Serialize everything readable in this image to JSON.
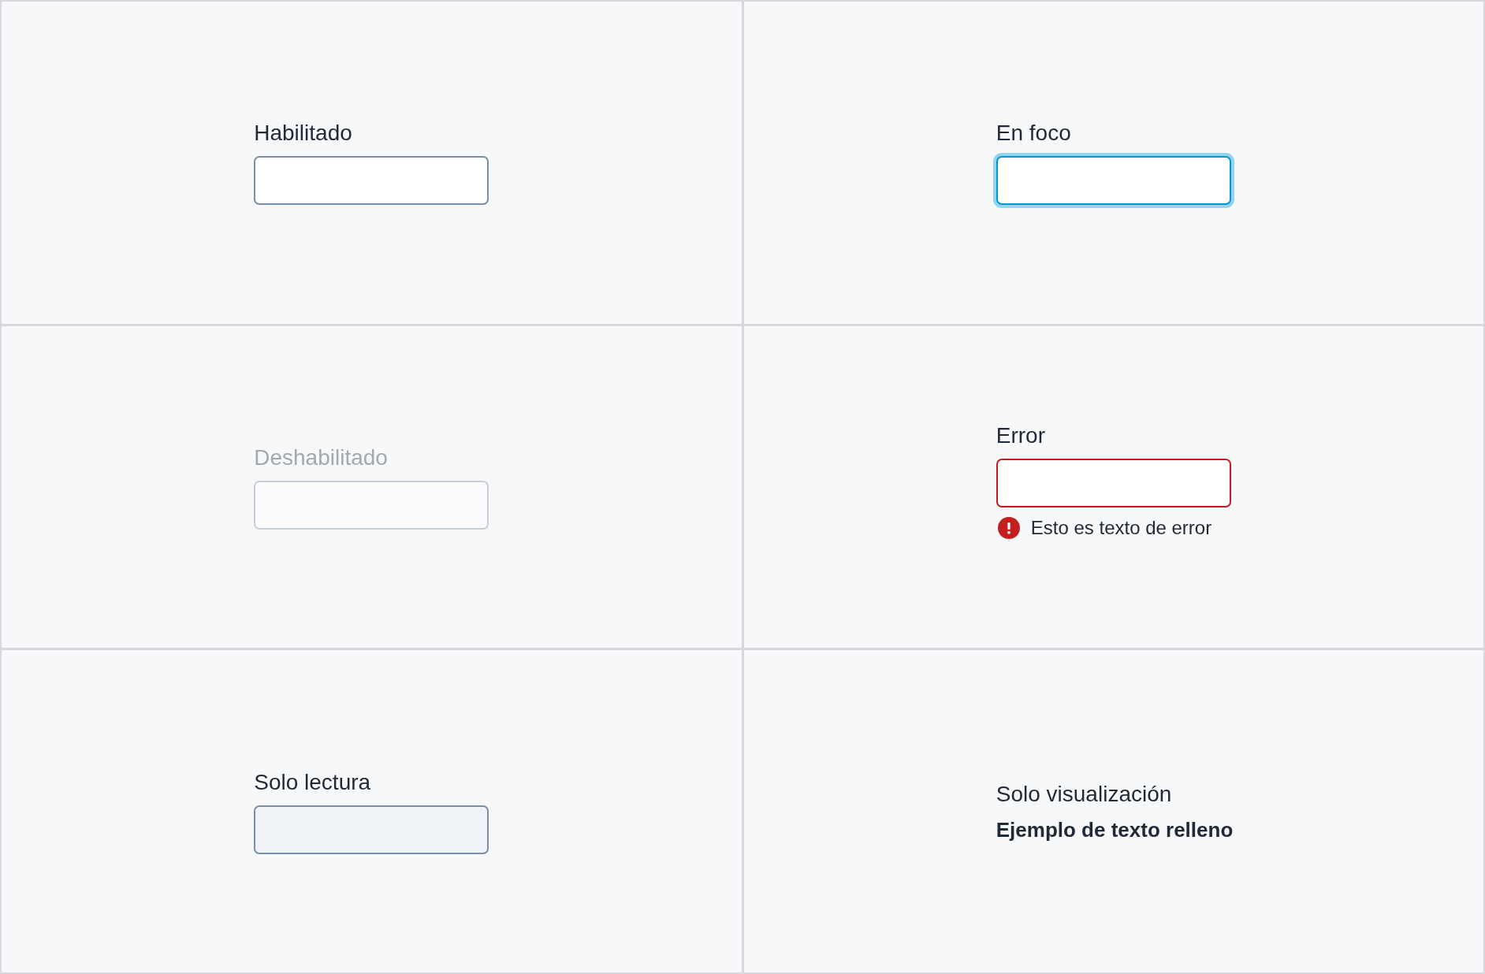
{
  "fields": [
    {
      "label": "Habilitado",
      "focused": false,
      "disabled": false,
      "readonly": false,
      "invalid": false
    },
    {
      "label": "Deshabilitado",
      "focused": false,
      "disabled": true,
      "readonly": false,
      "invalid": false
    },
    {
      "label": "Solo lectura",
      "focused": false,
      "disabled": false,
      "readonly": true,
      "invalid": false
    },
    {
      "label": "En foco",
      "focused": true,
      "disabled": false,
      "readonly": false,
      "invalid": false
    },
    {
      "label": "Error",
      "focused": false,
      "disabled": false,
      "readonly": false,
      "invalid": true,
      "error_text": "Esto es texto de error"
    }
  ],
  "display_field": {
    "label": "Solo visualización",
    "value": "Ejemplo de texto relleno"
  }
}
